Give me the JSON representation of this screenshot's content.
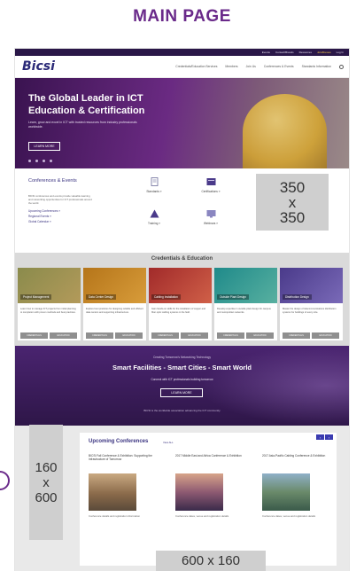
{
  "page_heading": "MAIN PAGE",
  "utility_bar": {
    "items": [
      "Events",
      "Contact/Brands",
      "Resources",
      "Join/Renew",
      "Log In"
    ]
  },
  "nav": {
    "logo": "Bicsi",
    "links": [
      "Credentials/Education Services",
      "Members",
      "Join Us",
      "Conferences & Events",
      "Standards Information"
    ]
  },
  "hero": {
    "title": "The Global Leader in ICT Education & Certification",
    "subtitle": "Learn, grow and excel in ICT with trusted resources from industry professionals worldwide.",
    "button": "LEARN MORE"
  },
  "conferences": {
    "title": "Conferences & Events",
    "text": "BICSI conferences and events provide valuable learning and networking opportunities for ICT professionals around the world.",
    "links": [
      "Upcoming Conferences »",
      "Regional Events »",
      "Global Calendar »"
    ],
    "quick_links": [
      "Standards »",
      "Certifications »",
      "Training »",
      "Webinars »"
    ]
  },
  "ad_box": {
    "l1": "350",
    "l2": "x",
    "l3": "350"
  },
  "credentials": {
    "title": "Credentials & Education",
    "cards": [
      {
        "label": "Project Management",
        "text": "Learn how to manage ICT projects from initial planning to completion with proven methods and best practices.",
        "btn1": "CREDENTIALS",
        "btn2": "EDUCATION",
        "color1": "#8a8b4c",
        "color2": "#b39a5a"
      },
      {
        "label": "Data Center Design",
        "text": "Explore best practices for designing reliable and efficient data centers and supporting infrastructure.",
        "btn1": "CREDENTIALS",
        "btn2": "EDUCATION",
        "color1": "#b5751a",
        "color2": "#d89c3a"
      },
      {
        "label": "Cabling Installation",
        "text": "Gain hands-on skills for the installation of copper and fiber optic cabling systems in the field.",
        "btn1": "CREDENTIALS",
        "btn2": "EDUCATION",
        "color1": "#a12a2a",
        "color2": "#d06048"
      },
      {
        "label": "Outside Plant Design",
        "text": "Develop expertise in outside plant design for campus and metropolitan networks.",
        "btn1": "CREDENTIALS",
        "btn2": "EDUCATION",
        "color1": "#1f8a8a",
        "color2": "#58b0a0"
      },
      {
        "label": "Distribution Design",
        "text": "Master the design of telecommunications distribution systems for buildings of every size.",
        "btn1": "CREDENTIALS",
        "btn2": "EDUCATION",
        "color1": "#4a3a8a",
        "color2": "#7a6ab8"
      }
    ]
  },
  "banner": {
    "pretitle": "Creating Tomorrow's Networking Technology",
    "title": "Smart Facilities - Smart Cities - Smart World",
    "subtitle": "Connect with ICT professionals building tomorrow",
    "button": "LEARN MORE",
    "footer": "BICSI is the worldwide association advancing the ICT community"
  },
  "upcoming": {
    "title": "Upcoming Conferences",
    "view_all": "View ALL",
    "arrow_prev": "‹",
    "arrow_next": "›",
    "events": [
      {
        "title": "BICSI Fall Conference & Exhibition: Supporting the Infrastructure of Tomorrow",
        "details": "Conference details and registration information"
      },
      {
        "title": "2017 Middle East and Africa Conference & Exhibition",
        "details": "Conference dates, venue and registration details"
      },
      {
        "title": "2017 Asia-Pacific Cabling Conference & Exhibition",
        "details": "Conference dates, venue and registration details"
      }
    ]
  },
  "skyscraper": {
    "l1": "160",
    "l2": "x",
    "l3": "600"
  },
  "leaderboard": {
    "label": "600 x 160"
  },
  "colors": {
    "brand_purple": "#6a2a8a",
    "nav_dark": "#2a1748",
    "link_blue": "#3a3380",
    "placeholder_gray": "#cfcfcf"
  }
}
